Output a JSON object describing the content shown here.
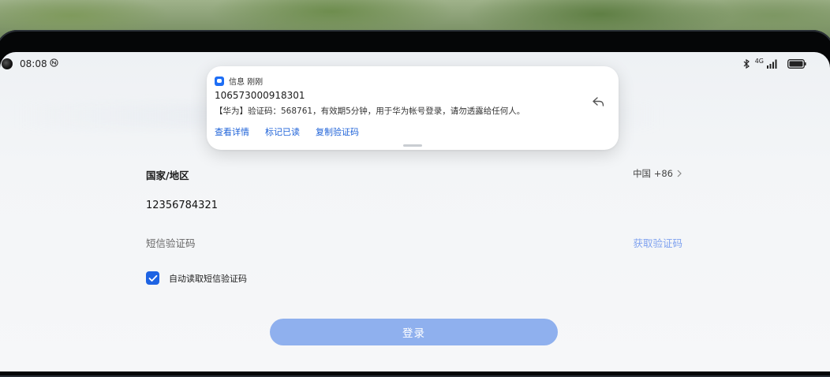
{
  "status_bar": {
    "time": "08:08",
    "network_label": "4G",
    "icons": [
      "nfc-icon",
      "bluetooth-icon",
      "signal-icon",
      "battery-icon"
    ]
  },
  "notification": {
    "app_name": "信息 刚刚",
    "sender": "106573000918301",
    "body": "【华为】验证码：568761，有效期5分钟，用于华为帐号登录，请勿透露给任何人。",
    "actions": [
      "查看详情",
      "标记已读",
      "复制验证码"
    ],
    "app_icon": "messages-app-icon",
    "reply_icon": "reply-icon"
  },
  "form": {
    "country_label": "国家/地区",
    "country_value": "中国 +86",
    "phone_number": "12356784321",
    "sms_code_placeholder": "短信验证码",
    "get_code_label": "获取验证码",
    "auto_read_label": "自动读取短信验证码",
    "auto_read_checked": true,
    "login_label": "登录"
  },
  "colors": {
    "accent": "#1e63e3",
    "link": "#1e62d8",
    "login_button": "#8fb0ee",
    "get_code": "#7fa2ef"
  }
}
